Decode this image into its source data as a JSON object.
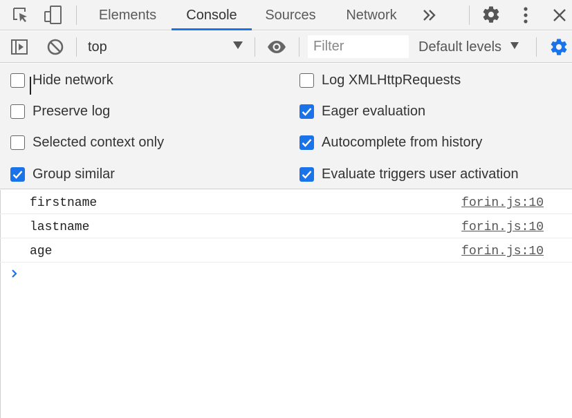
{
  "tabs": {
    "items": [
      {
        "label": "Elements"
      },
      {
        "label": "Console",
        "active": true
      },
      {
        "label": "Sources"
      },
      {
        "label": "Network"
      }
    ],
    "overflow_icon": "double-chevron-right-icon"
  },
  "toolbar": {
    "context": "top",
    "filter_placeholder": "Filter",
    "levels": "Default levels"
  },
  "settings": {
    "left": [
      {
        "label": "Hide network",
        "checked": false
      },
      {
        "label": "Preserve log",
        "checked": false
      },
      {
        "label": "Selected context only",
        "checked": false
      },
      {
        "label": "Group similar",
        "checked": true
      }
    ],
    "right": [
      {
        "label": "Log XMLHttpRequests",
        "checked": false
      },
      {
        "label": "Eager evaluation",
        "checked": true
      },
      {
        "label": "Autocomplete from history",
        "checked": true
      },
      {
        "label": "Evaluate triggers user activation",
        "checked": true
      }
    ]
  },
  "console": {
    "messages": [
      {
        "text": "firstname",
        "source": "forin.js:10"
      },
      {
        "text": "lastname",
        "source": "forin.js:10"
      },
      {
        "text": "age",
        "source": "forin.js:10"
      }
    ],
    "prompt_value": ""
  },
  "colors": {
    "accent": "#1a73e8",
    "toolbar_bg": "#f3f3f3"
  }
}
